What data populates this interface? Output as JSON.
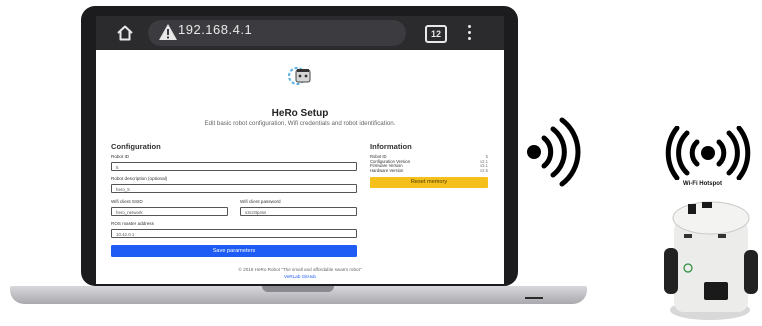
{
  "browser": {
    "url": "192.168.4.1",
    "tab_count": "12"
  },
  "page": {
    "title": "HeRo Setup",
    "subtitle": "Edit basic robot configuration, Wifi credentials and robot identification."
  },
  "configuration": {
    "heading": "Configuration",
    "robot_id_label": "Robot ID",
    "robot_id_value": "5",
    "description_label": "Robot description (optional)",
    "description_value": "hero_5",
    "ssid_label": "Wifi client SSID",
    "ssid_value": "hero_network",
    "password_label": "Wifi client password",
    "password_value": "s3cr3tp4ss",
    "ros_label": "ROS master address",
    "ros_value": "10.42.0.1",
    "save_label": "Save parameters"
  },
  "information": {
    "heading": "Information",
    "rows": [
      {
        "key": "Robot ID",
        "value": "5"
      },
      {
        "key": "Configuration Version",
        "value": "v2.1"
      },
      {
        "key": "Firmware Version",
        "value": "v3.1"
      },
      {
        "key": "Hardware Version",
        "value": "v2.5"
      }
    ],
    "reset_label": "Reset memory"
  },
  "footer": {
    "copyright": "© 2018 HeRo Robot \"The small and affordable swarm robot\"",
    "link": "VeRLab GitHub"
  },
  "side": {
    "hotspot_label": "Wi-Fi Hotspot"
  },
  "colors": {
    "primary": "#1f5cf5",
    "warning": "#f5c01c",
    "browser_bar": "#2b2b2e"
  },
  "icons": [
    "home-icon",
    "warning-icon",
    "tabs-icon",
    "menu-icon",
    "robot-logo-icon",
    "wifi-signal-icon",
    "wifi-hotspot-icon",
    "robot-photo"
  ]
}
